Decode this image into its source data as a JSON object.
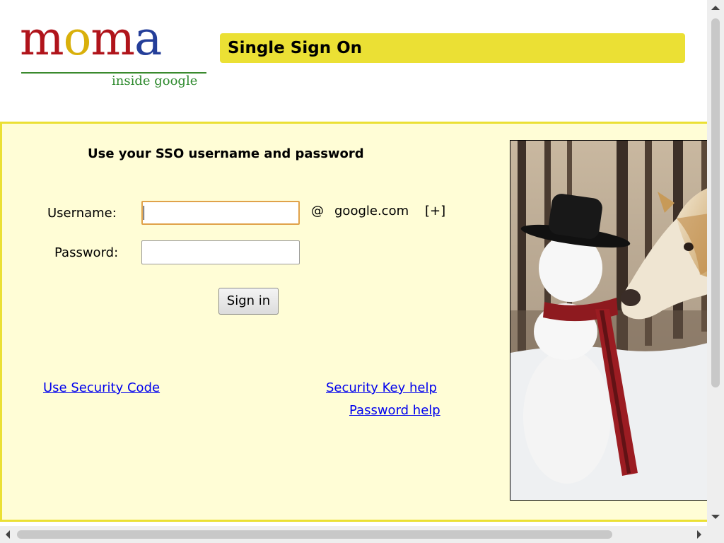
{
  "header": {
    "logo": {
      "letters": [
        "m",
        "o",
        "m",
        "a"
      ],
      "subtitle": "inside google"
    },
    "title": "Single Sign On",
    "title_bar_color": "#ebe034"
  },
  "form": {
    "heading": "Use your SSO username and password",
    "username_label": "Username:",
    "username_value": "",
    "password_label": "Password:",
    "password_value": "",
    "domain_at": "@",
    "domain": "google.com",
    "domain_toggle": "[+]",
    "signin_label": "Sign in",
    "panel_color": "#fffdd6"
  },
  "links": {
    "security_code": "Use Security Code",
    "security_key_help": "Security Key help",
    "password_help": "Password help"
  },
  "photo": {
    "icon": "snowman-and-horse-photo"
  }
}
